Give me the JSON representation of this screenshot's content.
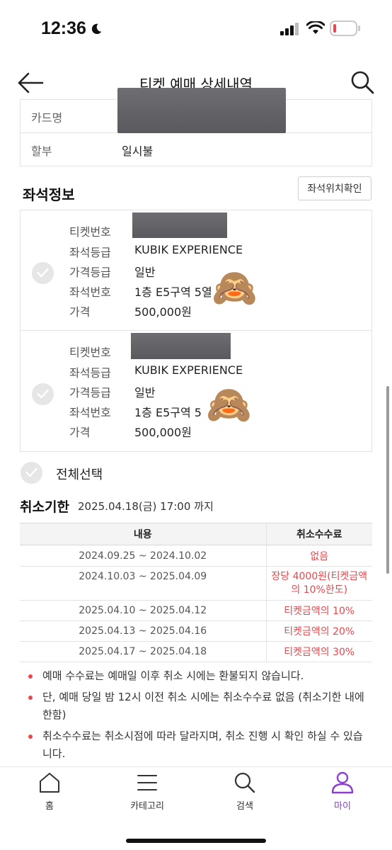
{
  "status_bar": {
    "time": "12:36"
  },
  "header": {
    "title": "티켓 예매 상세내역"
  },
  "payment": {
    "rows": [
      {
        "label": "카드명",
        "value": ""
      },
      {
        "label": "할부",
        "value": "일시불"
      }
    ]
  },
  "seat_section": {
    "title": "좌석정보",
    "location_button": "좌석위치확인",
    "seats": [
      {
        "ticket_label": "티켓번호",
        "ticket_value": "",
        "grade_label": "좌석등급",
        "grade_value": "KUBIK EXPERIENCE",
        "price_grade_label": "가격등급",
        "price_grade_value": "일반",
        "seat_label": "좌석번호",
        "seat_value": "1층 E5구역 5열",
        "price_label": "가격",
        "price_value": "500,000원"
      },
      {
        "ticket_label": "티켓번호",
        "ticket_value": "",
        "grade_label": "좌석등급",
        "grade_value": "KUBIK EXPERIENCE",
        "price_grade_label": "가격등급",
        "price_grade_value": "일반",
        "seat_label": "좌석번호",
        "seat_value": "1층 E5구역 5",
        "price_label": "가격",
        "price_value": "500,000원"
      }
    ],
    "select_all": "전체선택"
  },
  "cancel": {
    "title": "취소기한",
    "deadline": "2025.04.18(금) 17:00 까지",
    "table": {
      "headers": [
        "내용",
        "취소수수료"
      ],
      "rows": [
        {
          "period": "2024.09.25 ~ 2024.10.02",
          "fee": "없음"
        },
        {
          "period": "2024.10.03 ~ 2025.04.09",
          "fee": "장당 4000원(티켓금액의 10%한도)"
        },
        {
          "period": "2025.04.10 ~ 2025.04.12",
          "fee": "티켓금액의 10%"
        },
        {
          "period": "2025.04.13 ~ 2025.04.16",
          "fee": "티켓금액의 20%"
        },
        {
          "period": "2025.04.17 ~ 2025.04.18",
          "fee": "티켓금액의 30%"
        }
      ]
    },
    "notes": [
      "예매 수수료는 예매일 이후 취소 시에는 환불되지 않습니다.",
      "단, 예매 당일 밤 12시 이전 취소 시에는 취소수수료 없음 (취소기한 내에 한함)",
      "취소수수료는 취소시점에 따라 달라지며, 취소 진행 시 확인 하실 수 있습니다."
    ]
  },
  "bottom_nav": {
    "items": [
      {
        "label": "홈",
        "icon": "home-icon"
      },
      {
        "label": "카테고리",
        "icon": "menu-icon"
      },
      {
        "label": "검색",
        "icon": "search-icon"
      },
      {
        "label": "마이",
        "icon": "user-icon"
      }
    ]
  },
  "emoji": "🙈",
  "colors": {
    "accent": "#8a3fd1",
    "fee_red": "#e5484d"
  }
}
